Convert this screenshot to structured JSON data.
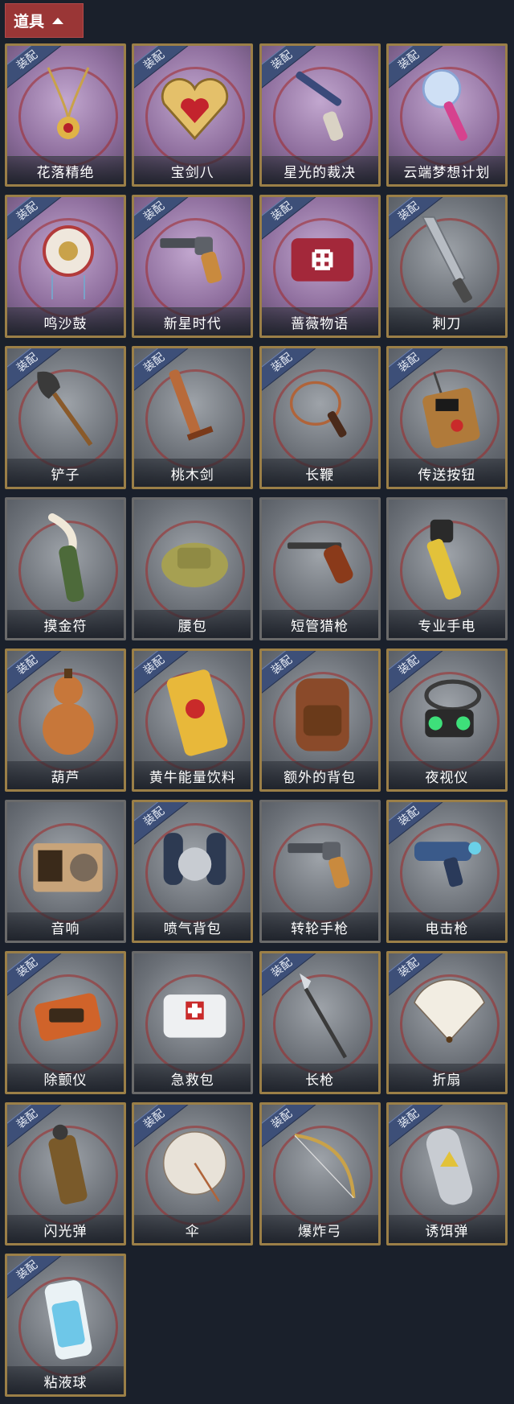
{
  "header": {
    "label": "道具"
  },
  "badge_text": "装配",
  "items": [
    {
      "name": "花落精绝",
      "equipped": true,
      "theme": "purple",
      "icon": "necklace-icon"
    },
    {
      "name": "宝剑八",
      "equipped": true,
      "theme": "purple",
      "icon": "heart-locket-icon"
    },
    {
      "name": "星光的裁决",
      "equipped": true,
      "theme": "purple",
      "icon": "flintlock-icon"
    },
    {
      "name": "云端梦想计划",
      "equipped": true,
      "theme": "purple",
      "icon": "scepter-icon"
    },
    {
      "name": "鸣沙鼓",
      "equipped": true,
      "theme": "purple",
      "icon": "drum-icon"
    },
    {
      "name": "新星时代",
      "equipped": true,
      "theme": "purple",
      "icon": "revolver-icon"
    },
    {
      "name": "蔷薇物语",
      "equipped": true,
      "theme": "purple",
      "icon": "medkit-icon"
    },
    {
      "name": "刺刀",
      "equipped": true,
      "theme": "gray",
      "icon": "bayonet-icon"
    },
    {
      "name": "铲子",
      "equipped": true,
      "theme": "gray",
      "icon": "shovel-icon"
    },
    {
      "name": "桃木剑",
      "equipped": true,
      "theme": "gray",
      "icon": "wooden-sword-icon"
    },
    {
      "name": "长鞭",
      "equipped": true,
      "theme": "gray",
      "icon": "whip-icon"
    },
    {
      "name": "传送按钮",
      "equipped": true,
      "theme": "gray",
      "icon": "teleport-button-icon"
    },
    {
      "name": "摸金符",
      "equipped": false,
      "theme": "gray",
      "icon": "talisman-icon"
    },
    {
      "name": "腰包",
      "equipped": false,
      "theme": "gray",
      "icon": "waist-bag-icon"
    },
    {
      "name": "短管猎枪",
      "equipped": false,
      "theme": "gray",
      "icon": "shotgun-icon"
    },
    {
      "name": "专业手电",
      "equipped": false,
      "theme": "gray",
      "icon": "flashlight-icon"
    },
    {
      "name": "葫芦",
      "equipped": true,
      "theme": "gray",
      "icon": "gourd-icon"
    },
    {
      "name": "黄牛能量饮料",
      "equipped": true,
      "theme": "gray",
      "icon": "energy-drink-icon"
    },
    {
      "name": "额外的背包",
      "equipped": true,
      "theme": "gray",
      "icon": "backpack-icon"
    },
    {
      "name": "夜视仪",
      "equipped": true,
      "theme": "gray",
      "icon": "night-vision-icon"
    },
    {
      "name": "音响",
      "equipped": false,
      "theme": "gray",
      "icon": "speaker-icon"
    },
    {
      "name": "喷气背包",
      "equipped": true,
      "theme": "gray",
      "icon": "jetpack-icon"
    },
    {
      "name": "转轮手枪",
      "equipped": false,
      "theme": "gray",
      "icon": "revolver-icon"
    },
    {
      "name": "电击枪",
      "equipped": true,
      "theme": "gray",
      "icon": "stun-gun-icon"
    },
    {
      "name": "除颤仪",
      "equipped": true,
      "theme": "gray",
      "icon": "defibrillator-icon"
    },
    {
      "name": "急救包",
      "equipped": false,
      "theme": "gray",
      "icon": "first-aid-icon"
    },
    {
      "name": "长枪",
      "equipped": true,
      "theme": "gray",
      "icon": "spear-icon"
    },
    {
      "name": "折扇",
      "equipped": true,
      "theme": "gray",
      "icon": "fan-icon"
    },
    {
      "name": "闪光弹",
      "equipped": true,
      "theme": "gray",
      "icon": "flashbang-icon"
    },
    {
      "name": "伞",
      "equipped": true,
      "theme": "gray",
      "icon": "umbrella-icon"
    },
    {
      "name": "爆炸弓",
      "equipped": true,
      "theme": "gray",
      "icon": "bow-icon"
    },
    {
      "name": "诱饵弹",
      "equipped": true,
      "theme": "gray",
      "icon": "decoy-icon"
    },
    {
      "name": "粘液球",
      "equipped": true,
      "theme": "gray",
      "icon": "slime-ball-icon"
    }
  ]
}
